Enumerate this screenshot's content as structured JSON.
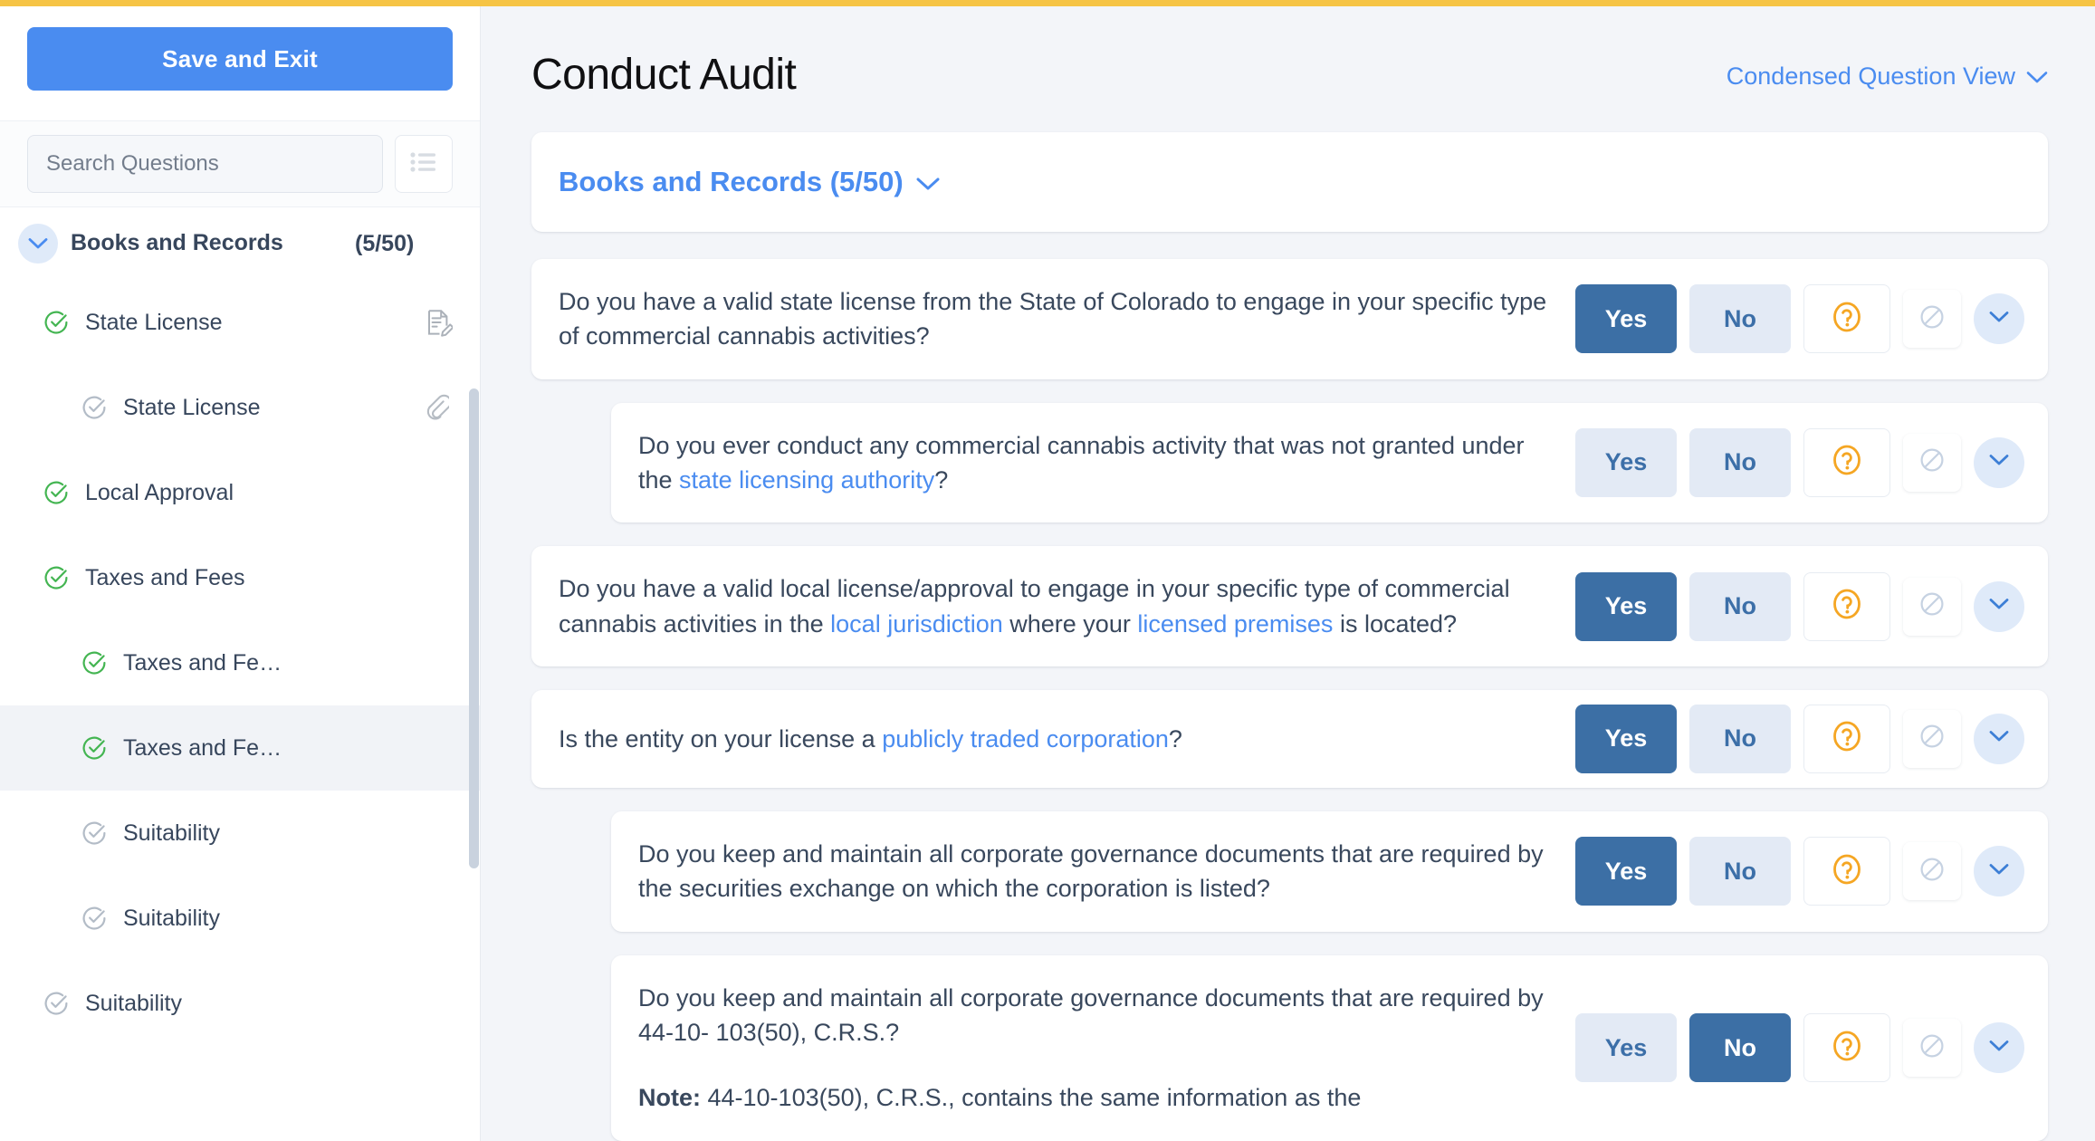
{
  "colors": {
    "top_accent": "#f6c445",
    "primary_blue": "#4a8cf0",
    "answer_selected": "#3c6fa5",
    "answer_idle_bg": "#e3eaf5",
    "help_orange": "#f5a623",
    "check_green": "#44b552",
    "check_grey": "#b3bcc7"
  },
  "sidebar": {
    "save_exit_label": "Save and Exit",
    "search": {
      "placeholder": "Search Questions",
      "value": ""
    },
    "list_view_icon": "list-icon",
    "group": {
      "title": "Books and Records",
      "count": "(5/50)",
      "expanded": true,
      "chevron_icon": "chevron-down-icon"
    },
    "items": [
      {
        "label": "State License",
        "level": 1,
        "status": "complete",
        "trail_icon": "note-edit-icon",
        "selected": false
      },
      {
        "label": "State License",
        "level": 2,
        "status": "incomplete",
        "trail_icon": "paperclip-icon",
        "selected": false
      },
      {
        "label": "Local Approval",
        "level": 1,
        "status": "complete",
        "trail_icon": "",
        "selected": false
      },
      {
        "label": "Taxes and Fees",
        "level": 1,
        "status": "complete",
        "trail_icon": "",
        "selected": false
      },
      {
        "label": "Taxes and Fe…",
        "level": 2,
        "status": "complete",
        "trail_icon": "",
        "selected": false
      },
      {
        "label": "Taxes and Fe…",
        "level": 2,
        "status": "complete",
        "trail_icon": "",
        "selected": true
      },
      {
        "label": "Suitability",
        "level": 2,
        "status": "incomplete",
        "trail_icon": "",
        "selected": false
      },
      {
        "label": "Suitability",
        "level": 2,
        "status": "incomplete",
        "trail_icon": "",
        "selected": false
      },
      {
        "label": "Suitability",
        "level": 1,
        "status": "incomplete",
        "trail_icon": "",
        "selected": false
      }
    ]
  },
  "main": {
    "page_title": "Conduct Audit",
    "view_toggle_label": "Condensed Question View",
    "view_toggle_icon": "chevron-down-icon",
    "section": {
      "title": "Books and Records (5/50)",
      "chevron_icon": "chevron-down-icon"
    },
    "answer_labels": {
      "yes": "Yes",
      "no": "No"
    },
    "icons": {
      "help": "question-circle-icon",
      "not_applicable": "circle-slash-icon",
      "expand": "chevron-down-icon"
    },
    "questions": [
      {
        "indent": "parent",
        "selected": "yes",
        "parts": [
          {
            "t": "Do you have a valid state license from the State of Colorado to engage in your specific type of commercial cannabis activities?",
            "link": false
          }
        ]
      },
      {
        "indent": "child",
        "selected": "none",
        "parts": [
          {
            "t": "Do you ever conduct any commercial cannabis activity that was not granted under the ",
            "link": false
          },
          {
            "t": "state licensing authority",
            "link": true
          },
          {
            "t": "?",
            "link": false
          }
        ]
      },
      {
        "indent": "parent",
        "selected": "yes",
        "parts": [
          {
            "t": "Do you have a valid local license/approval to engage in your specific type of commercial cannabis activities in the ",
            "link": false
          },
          {
            "t": "local jurisdiction",
            "link": true
          },
          {
            "t": " where your ",
            "link": false
          },
          {
            "t": "licensed premises",
            "link": true
          },
          {
            "t": " is located?",
            "link": false
          }
        ]
      },
      {
        "indent": "parent",
        "selected": "yes",
        "parts": [
          {
            "t": "Is the entity on your license a ",
            "link": false
          },
          {
            "t": "publicly traded corporation",
            "link": true
          },
          {
            "t": "?",
            "link": false
          }
        ]
      },
      {
        "indent": "child",
        "selected": "yes",
        "parts": [
          {
            "t": "Do you keep and maintain all corporate governance documents that are required by the securities exchange on which the corporation is listed?",
            "link": false
          }
        ]
      },
      {
        "indent": "child",
        "selected": "no",
        "parts": [
          {
            "t": "Do you keep and maintain all corporate governance documents that are required by 44-10- 103(50), C.R.S.?",
            "link": false
          }
        ],
        "note_prefix": "Note:",
        "note_text": " 44-10-103(50), C.R.S., contains the same information as the"
      }
    ]
  }
}
